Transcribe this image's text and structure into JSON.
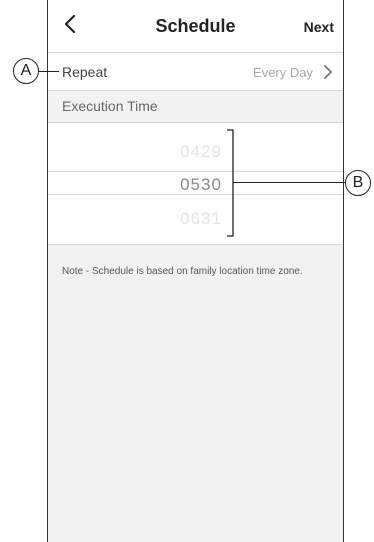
{
  "header": {
    "title": "Schedule",
    "next_label": "Next"
  },
  "repeat": {
    "label": "Repeat",
    "value": "Every Day"
  },
  "execution": {
    "section_label": "Execution Time",
    "rows": [
      {
        "hour": "04",
        "minute": "29"
      },
      {
        "hour": "05",
        "minute": "30"
      },
      {
        "hour": "06",
        "minute": "31"
      }
    ]
  },
  "note": "Note - Schedule is based on family location time zone.",
  "callouts": {
    "a": "A",
    "b": "B"
  },
  "icons": {
    "back": "chevron-left-icon",
    "repeat_arrow": "chevron-right-icon"
  },
  "colors": {
    "background": "#f2f2f2",
    "surface": "#ffffff",
    "muted_text": "#a8a8a8",
    "divider": "#d6d6d6"
  }
}
